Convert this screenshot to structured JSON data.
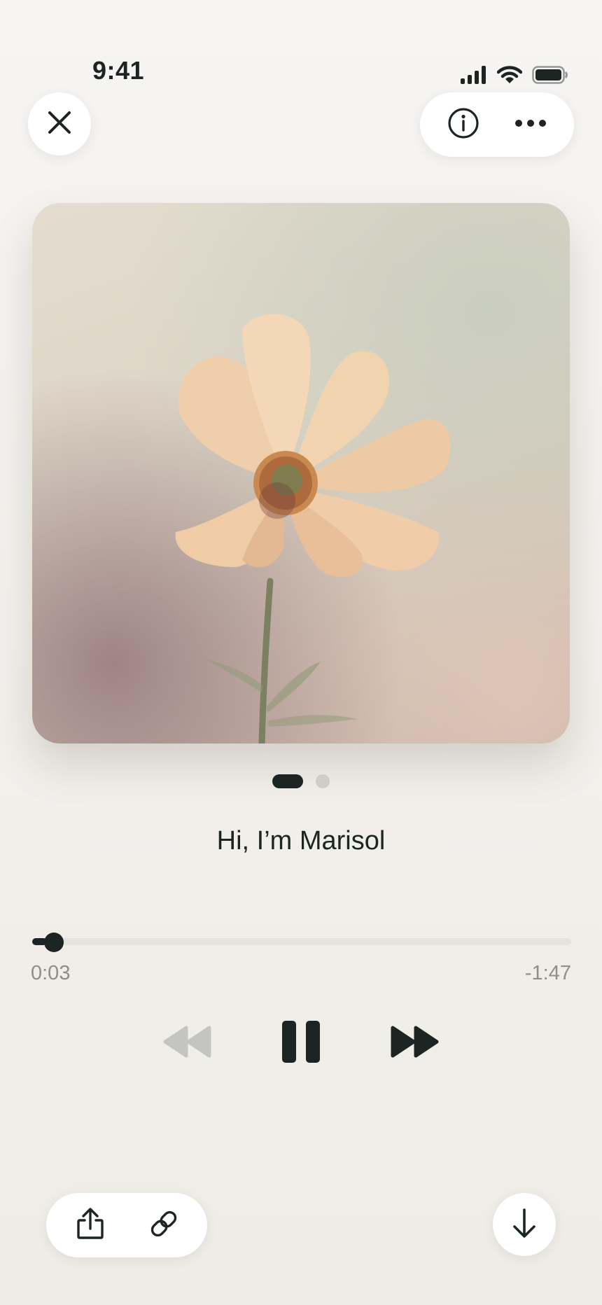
{
  "status_bar": {
    "time": "9:41",
    "icons": [
      "cellular-signal-icon",
      "wifi-icon",
      "battery-icon"
    ]
  },
  "top_bar": {
    "close_icon": "close-icon",
    "info_icon": "info-icon",
    "more_icon": "more-icon"
  },
  "artwork": {
    "pager": {
      "pages": 2,
      "current": 1
    }
  },
  "track": {
    "title": "Hi, I’m Marisol"
  },
  "player": {
    "elapsed": "0:03",
    "remaining": "-1:47",
    "progress": 0.027,
    "rewind_enabled": false,
    "is_playing": true
  },
  "bottom_bar": {
    "share_icon": "share-icon",
    "link_icon": "link-icon",
    "download_icon": "download-icon"
  },
  "colors": {
    "primary": "#1d2523",
    "muted_text": "#8f8e8a",
    "disabled": "#c4c4c2",
    "track": "#e5e3de",
    "surface": "#ffffff"
  }
}
